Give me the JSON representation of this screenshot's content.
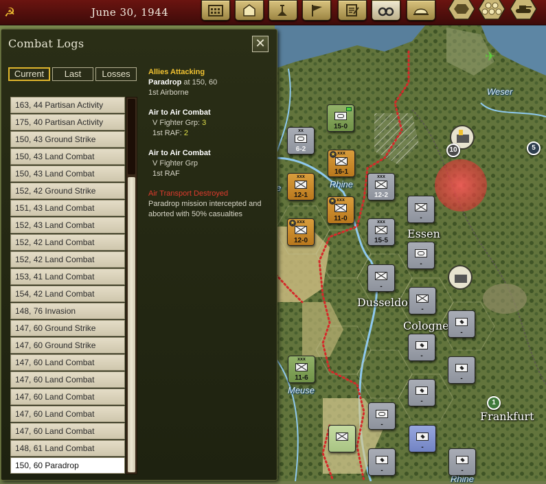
{
  "topbar": {
    "date": "June 30, 1944",
    "tools": [
      "calendar-icon",
      "hq-icon",
      "research-icon",
      "flag-icon",
      "orders-icon",
      "binoculars-icon",
      "helmet-icon"
    ],
    "hex_tools": [
      "hex-single-icon",
      "hex-cluster-icon",
      "tank-icon"
    ]
  },
  "panel": {
    "title": "Combat Logs",
    "close": "✕",
    "tabs": [
      {
        "label": "Current",
        "active": true
      },
      {
        "label": "Last",
        "active": false
      },
      {
        "label": "Losses",
        "active": false
      }
    ],
    "logs": [
      "163, 44 Partisan Activity",
      "175, 40 Partisan Activity",
      "150, 43 Ground Strike",
      "150, 43 Land Combat",
      "150, 43 Land Combat",
      "152, 42 Ground Strike",
      "151, 43 Land Combat",
      "152, 43 Land Combat",
      "152, 42 Land Combat",
      "152, 42 Land Combat",
      "153, 41 Land Combat",
      "154, 42 Land Combat",
      "148, 76 Invasion",
      "147, 60 Ground Strike",
      "147, 60 Ground Strike",
      "147, 60 Land Combat",
      "147, 60 Land Combat",
      "147, 60 Land Combat",
      "147, 60 Land Combat",
      "147, 60 Land Combat",
      "148, 61 Land Combat",
      "150, 60 Paradrop"
    ],
    "selected_index": 21,
    "detail": {
      "header": "Allies Attacking",
      "event": "Paradrop",
      "event_loc": " at 150, 60",
      "unit": "1st Airborne",
      "combat1": {
        "title": "Air to Air Combat",
        "line1_label": "V Fighter Grp: ",
        "line1_value": "3",
        "line2_label": "1st RAF: ",
        "line2_value": "2"
      },
      "combat2": {
        "title": "Air to Air Combat",
        "line1": "V Fighter Grp",
        "line2": "1st RAF"
      },
      "result_title": "Air Transport Destroyed",
      "result_text": "Paradrop mission intercepted and aborted with 50% casualties"
    }
  },
  "map": {
    "cities": [
      "Essen",
      "Dusseldorf",
      "Cologne",
      "Frankfurt"
    ],
    "rivers": [
      "Weser",
      "Rhine",
      "Meuse",
      "Rhine"
    ],
    "river_partial": "e",
    "counters": [
      {
        "size": "xx",
        "value": "6-2"
      },
      {
        "size": "",
        "value": "15-0"
      },
      {
        "size": "xxx",
        "value": "16-1"
      },
      {
        "size": "xxx",
        "value": "12-1"
      },
      {
        "size": "xxx",
        "value": "11-0"
      },
      {
        "size": "xxx",
        "value": "12-2"
      },
      {
        "size": "xxx",
        "value": "12-0"
      },
      {
        "size": "xxx",
        "value": "15-5"
      },
      {
        "size": "xxx",
        "value": "11-6"
      },
      {
        "size": "",
        "value": "-"
      }
    ],
    "badges": [
      "10",
      "5",
      "1"
    ]
  }
}
